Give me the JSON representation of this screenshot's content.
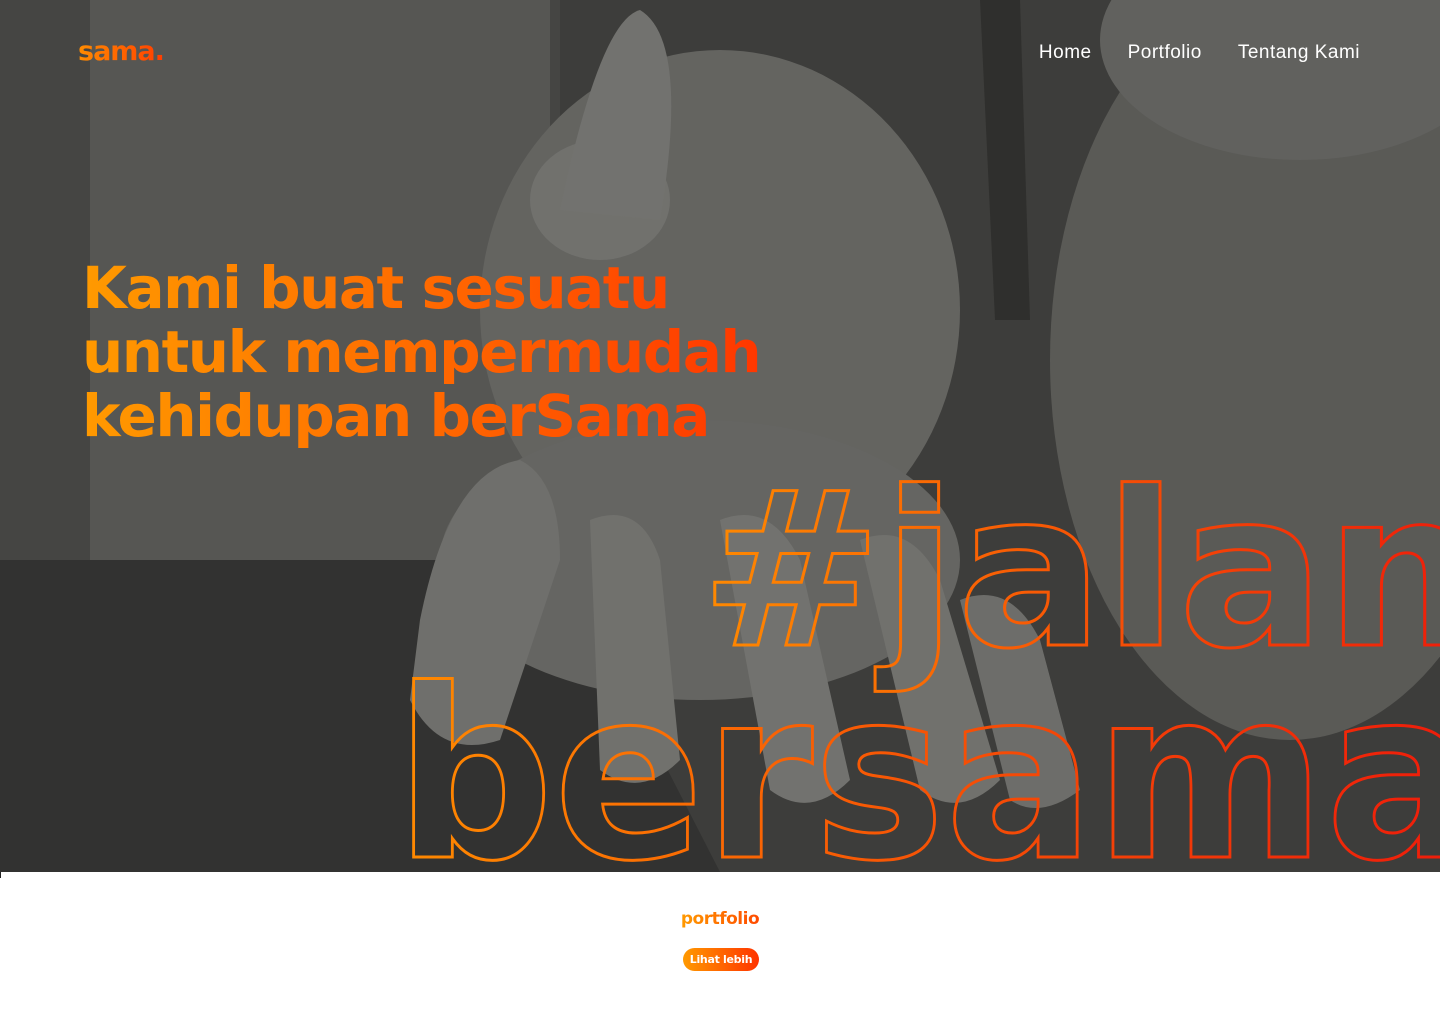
{
  "header": {
    "logo": "sama.",
    "nav": [
      {
        "label": "Home"
      },
      {
        "label": "Portfolio"
      },
      {
        "label": "Tentang Kami"
      }
    ]
  },
  "hero": {
    "headline_line1": "Kami buat sesuatu",
    "headline_line2": "untuk mempermudah",
    "headline_line3": "kehidupan berSama",
    "outline_line1": "#jalan",
    "outline_line2": "bersama",
    "background_image": "robot-hand-photo"
  },
  "portfolio": {
    "title": "portfolio",
    "more_button": "Lihat lebih"
  },
  "colors": {
    "accent_start": "#ff9a00",
    "accent_end": "#ff2a00",
    "hero_overlay": "#4e4e4b"
  }
}
